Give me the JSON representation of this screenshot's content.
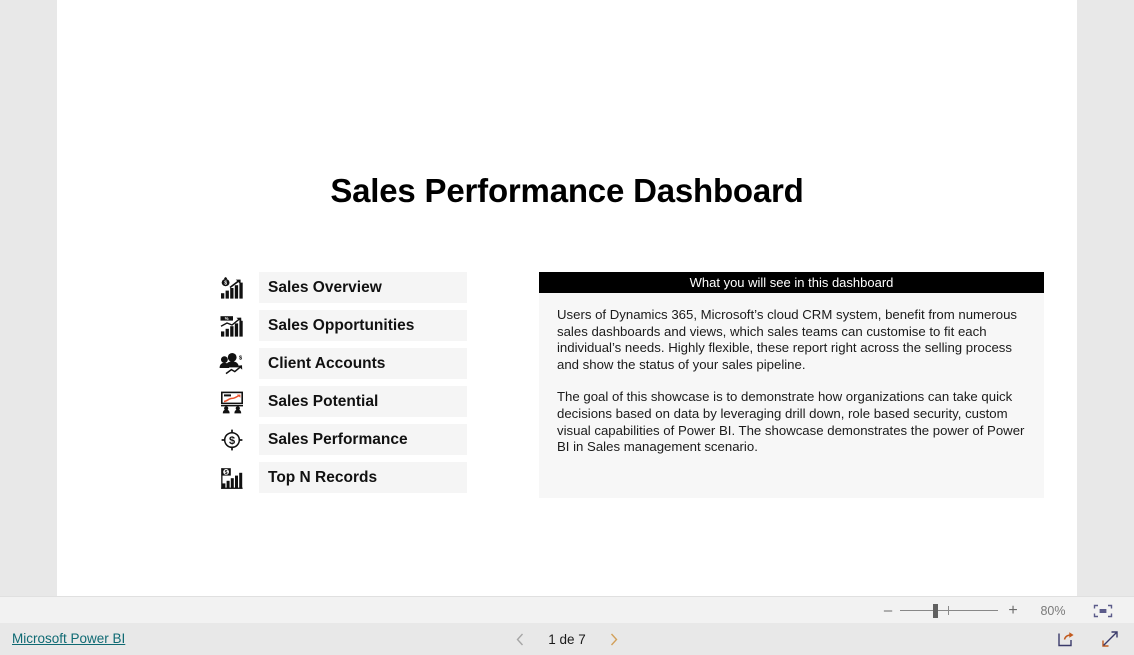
{
  "report": {
    "title": "Sales Performance Dashboard",
    "nav_items": [
      {
        "label": "Sales Overview",
        "icon": "money-bag-bar-chart-icon"
      },
      {
        "label": "Sales Opportunities",
        "icon": "bar-chart-trend-icon"
      },
      {
        "label": "Client Accounts",
        "icon": "people-dollar-icon"
      },
      {
        "label": "Sales Potential",
        "icon": "presentation-board-icon"
      },
      {
        "label": "Sales Performance",
        "icon": "target-dollar-icon"
      },
      {
        "label": "Top N Records",
        "icon": "dollar-bar-chart-icon"
      }
    ],
    "info_panel": {
      "header": "What you will see in this dashboard",
      "paragraphs": [
        "Users of Dynamics 365, Microsoft’s cloud CRM system, benefit from numerous sales dashboards and views, which sales teams can customise to fit each individual’s needs. Highly flexible, these report right across the selling process and show the status of your sales pipeline.",
        "The goal of this showcase is to demonstrate how organizations can take quick decisions based on data by leveraging drill down, role based security, custom visual capabilities of Power BI. The showcase demonstrates the power of Power BI in Sales management scenario."
      ]
    }
  },
  "zoom_bar": {
    "zoom_out_label": "–",
    "zoom_in_label": "+",
    "zoom_percent": "80%",
    "fit_page_icon": "fit-to-page-icon"
  },
  "footer": {
    "brand_link": "Microsoft Power BI",
    "prev_icon": "chevron-left-icon",
    "next_icon": "chevron-right-icon",
    "page_label": "1 de 7",
    "share_icon": "share-icon",
    "fullscreen_icon": "fullscreen-icon"
  },
  "colors": {
    "app_background": "#e8e8e8",
    "canvas": "#ffffff",
    "panel_header": "#000000",
    "panel_body": "#f7f7f7",
    "nav_pill": "#f5f5f5",
    "link": "#0f6a73"
  }
}
